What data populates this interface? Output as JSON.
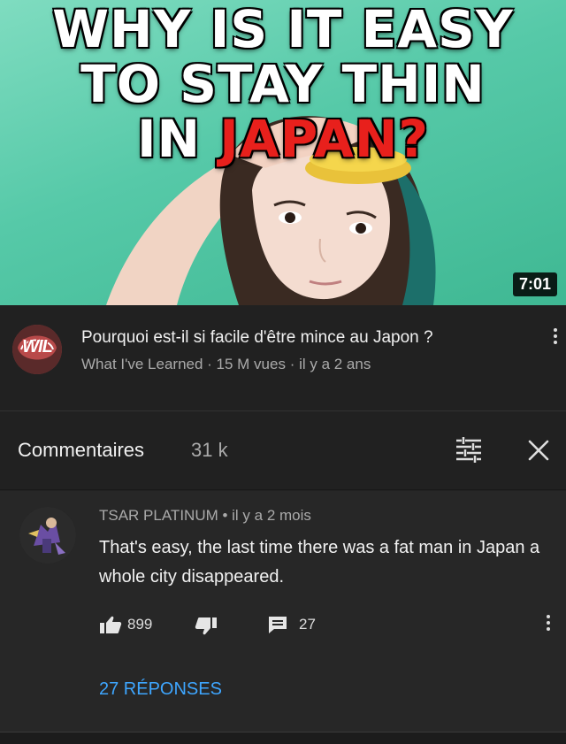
{
  "thumbnail": {
    "title_lines": [
      "WHY IS IT EASY",
      "TO STAY THIN"
    ],
    "title_line3_prefix": "IN ",
    "title_line3_highlight": "JAPAN?",
    "highlight_color": "#e8201c",
    "duration": "7:01"
  },
  "video": {
    "channel_avatar_text": "WIL",
    "title": "Pourquoi est-il si facile d'être mince au Japon ?",
    "meta": "What I've Learned · 15 M vues · il y a 2 ans",
    "menu_icon": "more-vert-icon"
  },
  "comments": {
    "label": "Commentaires",
    "count": "31 k",
    "sort_icon": "sort-icon",
    "close_icon": "close-icon"
  },
  "comment": {
    "author_line": "TSAR PLATINUM • il y a 2 mois",
    "text": "That's easy, the last time there was a fat man in Japan a whole city disappeared.",
    "likes": "899",
    "replies_count": "27",
    "replies_link": "27 RÉPONSES",
    "link_color": "#3ea6ff"
  }
}
